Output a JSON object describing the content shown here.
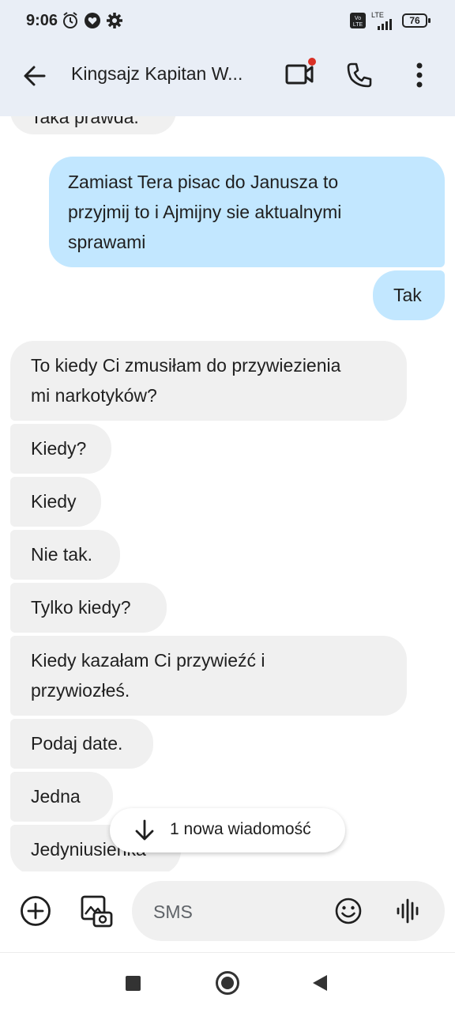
{
  "status_bar": {
    "time": "9:06",
    "network": "LTE",
    "battery": "76",
    "icons": [
      "alarm-icon",
      "heart-icon",
      "settings-icon",
      "volte-icon",
      "signal-icon",
      "battery-icon"
    ]
  },
  "app_bar": {
    "title": "Kingsajz Kapitan W...",
    "icons": [
      "back-arrow-icon",
      "video-call-icon",
      "phone-icon",
      "more-vert-icon"
    ]
  },
  "messages": [
    {
      "dir": "in",
      "lines": [
        "Taka prawda."
      ]
    },
    {
      "dir": "out",
      "lines": [
        "Zamiast Tera pisac do Janusza to",
        "przyjmij to i Ajmijny sie aktualnymi",
        "sprawami"
      ]
    },
    {
      "dir": "out",
      "lines": [
        "Tak"
      ]
    },
    {
      "dir": "in",
      "lines": [
        "To kiedy Ci zmusiłam do przywiezienia",
        "mi narkotyków?"
      ]
    },
    {
      "dir": "in",
      "lines": [
        "Kiedy?"
      ]
    },
    {
      "dir": "in",
      "lines": [
        "Kiedy"
      ]
    },
    {
      "dir": "in",
      "lines": [
        "Nie tak."
      ]
    },
    {
      "dir": "in",
      "lines": [
        "Tylko kiedy?"
      ]
    },
    {
      "dir": "in",
      "lines": [
        "Kiedy kazałam Ci przywieźć i",
        "przywiozłeś."
      ]
    },
    {
      "dir": "in",
      "lines": [
        "Podaj date."
      ]
    },
    {
      "dir": "in",
      "lines": [
        "Jedna"
      ]
    },
    {
      "dir": "in",
      "lines": [
        "Jedyniusieńka"
      ]
    }
  ],
  "new_message_chip": {
    "label": "1 nowa wiadomość"
  },
  "composer": {
    "placeholder": "SMS",
    "icons": [
      "add-icon",
      "gallery-icon",
      "emoji-icon",
      "voice-icon"
    ]
  },
  "nav_bar": {
    "icons": [
      "recents-square-icon",
      "home-circle-icon",
      "back-triangle-icon"
    ]
  },
  "colors": {
    "header_bg": "#e9eef6",
    "incoming_bubble": "#f0f0f0",
    "outgoing_bubble": "#c2e7ff",
    "notification_dot": "#d93025"
  }
}
